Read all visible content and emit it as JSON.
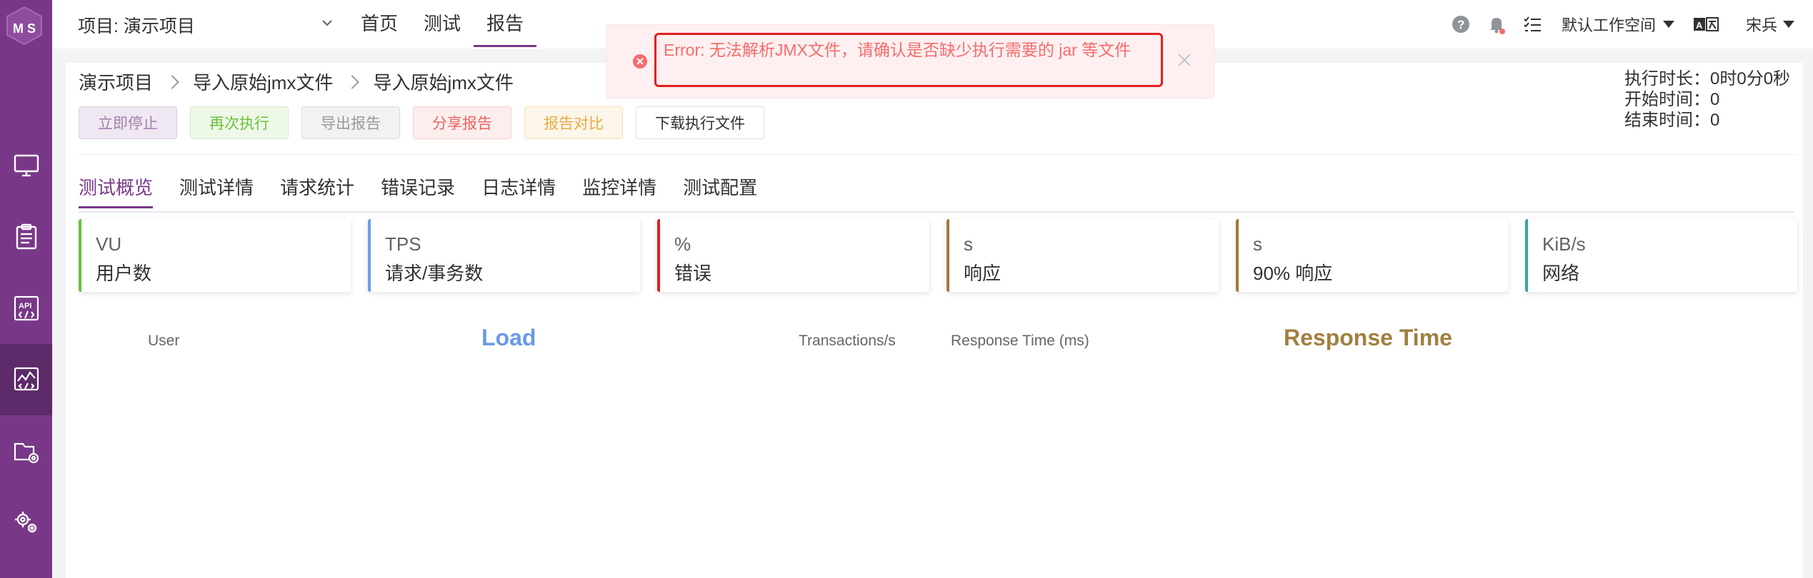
{
  "header": {
    "project_label": "项目: 演示项目",
    "nav": [
      {
        "label": "首页",
        "active": false
      },
      {
        "label": "测试",
        "active": false
      },
      {
        "label": "报告",
        "active": true
      }
    ],
    "workspace": "默认工作空间",
    "user": "宋兵"
  },
  "sidebar": {
    "items": [
      {
        "icon": "monitor-icon"
      },
      {
        "icon": "clipboard-icon"
      },
      {
        "icon": "api-icon"
      },
      {
        "icon": "performance-icon",
        "active": true
      },
      {
        "icon": "folder-settings-icon"
      },
      {
        "icon": "gears-icon"
      }
    ]
  },
  "breadcrumb": [
    "演示项目",
    "导入原始jmx文件",
    "导入原始jmx文件"
  ],
  "actions": {
    "stop": "立即停止",
    "rerun": "再次执行",
    "export": "导出报告",
    "share": "分享报告",
    "compare": "报告对比",
    "download": "下载执行文件"
  },
  "timing": {
    "duration": "执行时长：0时0分0秒",
    "start": "开始时间：0",
    "end": "结束时间：0"
  },
  "tabs": [
    {
      "label": "测试概览",
      "active": true
    },
    {
      "label": "测试详情"
    },
    {
      "label": "请求统计"
    },
    {
      "label": "错误记录"
    },
    {
      "label": "日志详情"
    },
    {
      "label": "监控详情"
    },
    {
      "label": "测试配置"
    }
  ],
  "cards": [
    {
      "value": "VU",
      "label": "用户数",
      "color": "#67c23a"
    },
    {
      "value": "TPS",
      "label": "请求/事务数",
      "color": "#6d9ee8"
    },
    {
      "value": "%",
      "label": "错误",
      "color": "#e02020"
    },
    {
      "value": "s",
      "label": "响应",
      "color": "#a07840"
    },
    {
      "value": "s",
      "label": "90% 响应",
      "color": "#a07840"
    },
    {
      "value": "KiB/s",
      "label": "网络",
      "color": "#3aa5a0"
    }
  ],
  "charts": {
    "load_axis_left": "User",
    "load_title": "Load",
    "load_axis_right": "Transactions/s",
    "rt_axis_left": "Response Time (ms)",
    "rt_title": "Response Time"
  },
  "toast": {
    "message": "Error: 无法解析JMX文件，请确认是否缺少执行需要的 jar 等文件"
  },
  "colors": {
    "primary": "#783887",
    "error": "#f56c6c"
  }
}
